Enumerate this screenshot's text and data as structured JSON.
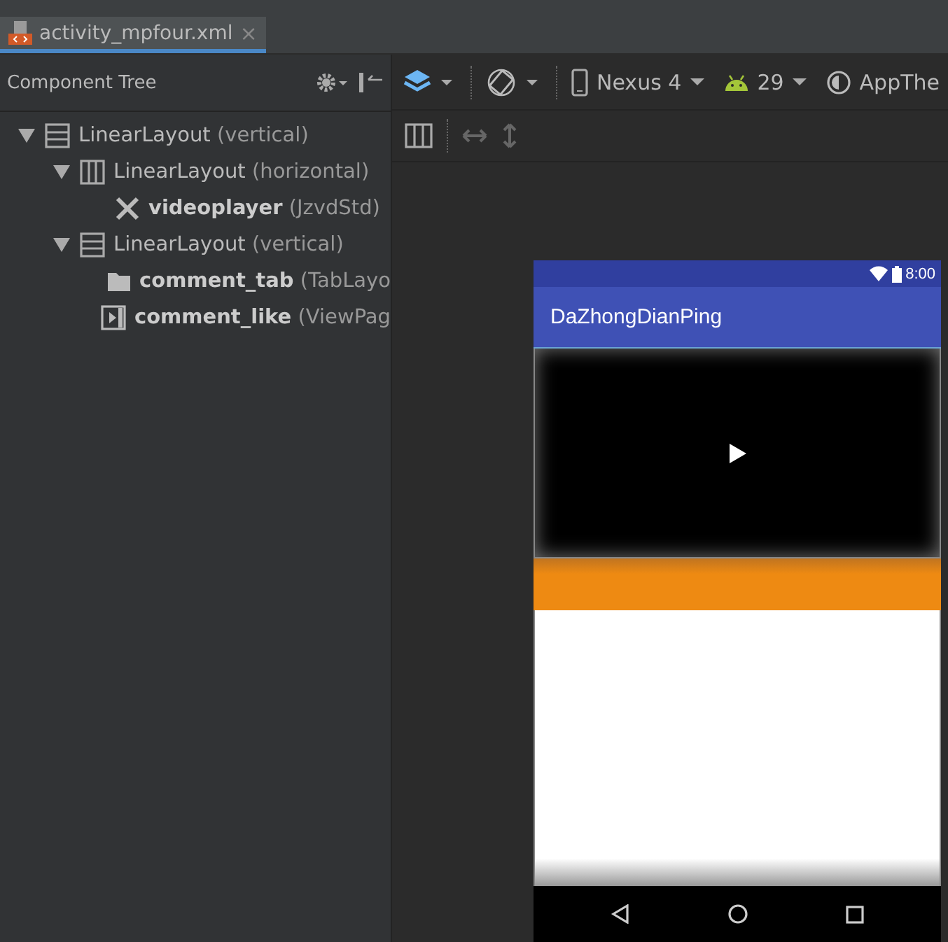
{
  "editor_tabs": [
    {
      "label": "activity_mpfour.xml",
      "selected": true,
      "close": "×"
    }
  ],
  "component_tree": {
    "title": "Component Tree",
    "nodes": [
      {
        "kind": "vertical",
        "name": "LinearLayout",
        "detail": "(vertical)",
        "bold": false,
        "expanded": true,
        "children": [
          {
            "kind": "horizontal",
            "name": "LinearLayout",
            "detail": "(horizontal)",
            "bold": false,
            "expanded": true,
            "children": [
              {
                "kind": "tool",
                "name": "videoplayer",
                "detail": "(JzvdStd)",
                "bold": true
              }
            ]
          },
          {
            "kind": "vertical",
            "name": "LinearLayout",
            "detail": "(vertical)",
            "bold": false,
            "expanded": true,
            "children": [
              {
                "kind": "folder",
                "name": "comment_tab",
                "detail": "(TabLayo",
                "bold": true
              },
              {
                "kind": "pager",
                "name": "comment_like",
                "detail": "(ViewPag",
                "bold": true
              }
            ]
          }
        ]
      }
    ]
  },
  "toolbar": {
    "device": "Nexus 4",
    "api": "29",
    "theme": "AppThe"
  },
  "phone": {
    "time": "8:00",
    "app_title": "DaZhongDianPing"
  }
}
